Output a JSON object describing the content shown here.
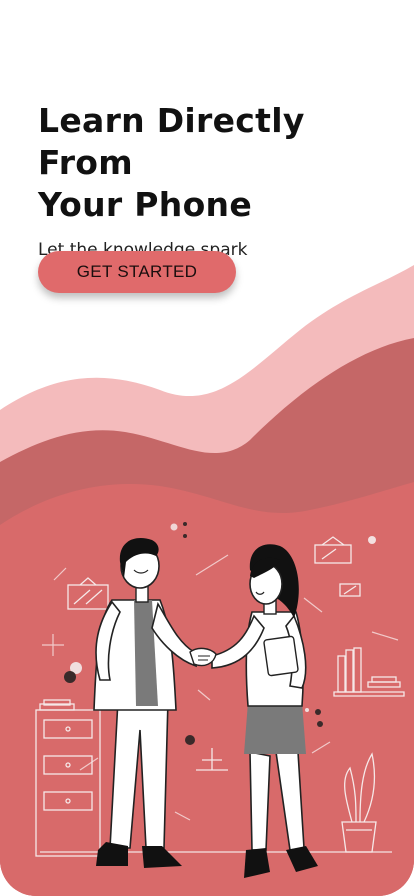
{
  "onboarding": {
    "title_line1": "Learn Directly From",
    "title_line2": "Your Phone",
    "subtitle": "Let the knowledge spark",
    "cta_label": "GET STARTED"
  },
  "illustration": {
    "subject": "two people shaking hands in an office",
    "icons": [
      "framed-picture-icon",
      "bookshelf-icon",
      "filing-cabinet-icon",
      "potted-plant-icon",
      "desk-lamp-icon"
    ]
  },
  "colors": {
    "accent": "#e06a6b",
    "wave_light": "#f4bbbc",
    "wave_mid": "#c56767",
    "wave_front": "#d86a6a",
    "background": "#ffffff"
  }
}
